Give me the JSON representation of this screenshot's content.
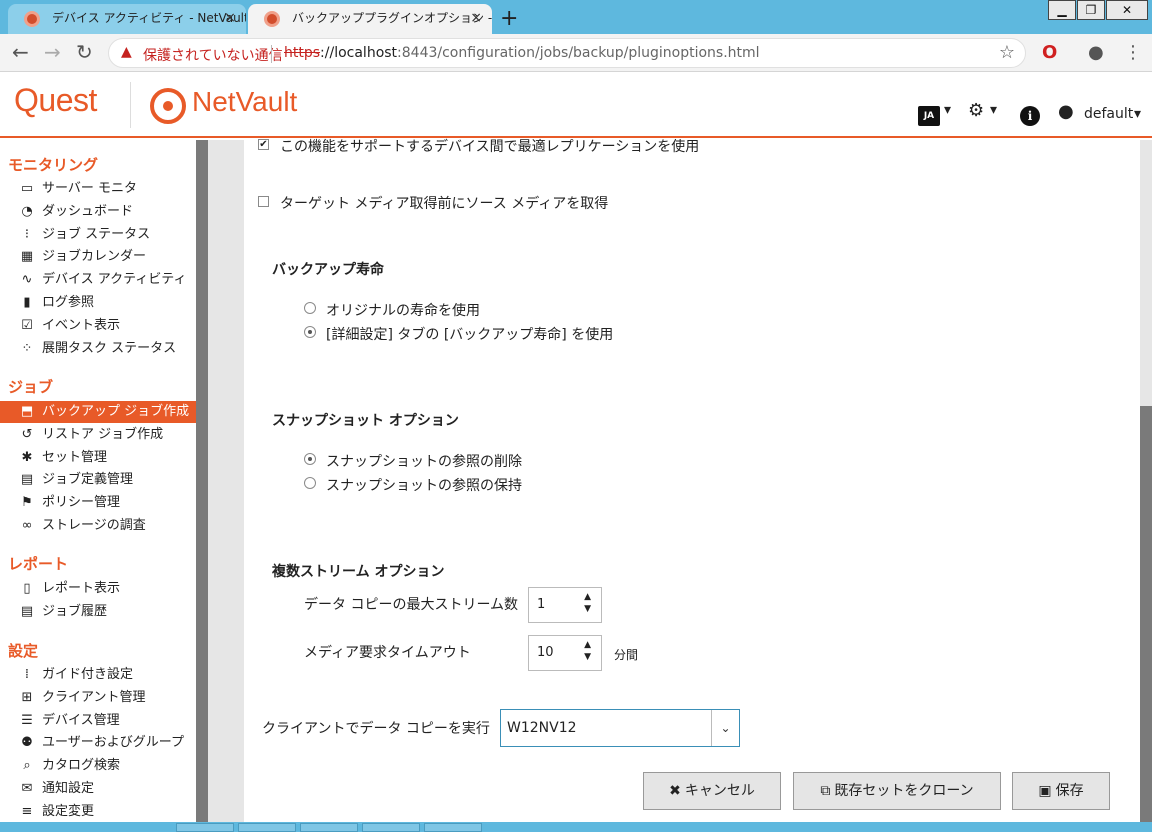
{
  "browser": {
    "tabs": [
      {
        "title": "デバイス アクティビティ - NetVault",
        "close": "×"
      },
      {
        "title": "バックアッププラグインオプション - Net",
        "close": "×"
      }
    ],
    "new_tab": "+",
    "window_controls": {
      "minimize": "▁",
      "maximize": "❐",
      "close": "✕"
    },
    "nav": {
      "back": "←",
      "forward": "→",
      "reload": "↻"
    },
    "security_text": "保護されていない通信",
    "url_scheme": "https",
    "url_host": "://localhost",
    "url_rest": ":8443/configuration/jobs/backup/pluginoptions.html"
  },
  "header": {
    "brand": "Quest",
    "product": "NetVault",
    "lang": "JA",
    "user": "default"
  },
  "sidebar": {
    "sections": [
      {
        "title": "モニタリング",
        "items": [
          {
            "icon": "monitor-icon",
            "glyph": "▭",
            "label": "サーバー モニタ"
          },
          {
            "icon": "dashboard-icon",
            "glyph": "◔",
            "label": "ダッシュボード"
          },
          {
            "icon": "traffic-light-icon",
            "glyph": "⁝",
            "label": "ジョブ ステータス"
          },
          {
            "icon": "calendar-icon",
            "glyph": "▦",
            "label": "ジョブカレンダー"
          },
          {
            "icon": "activity-icon",
            "glyph": "∿",
            "label": "デバイス アクティビティ"
          },
          {
            "icon": "log-icon",
            "glyph": "▮",
            "label": "ログ参照"
          },
          {
            "icon": "event-icon",
            "glyph": "☑",
            "label": "イベント表示"
          },
          {
            "icon": "spinner-icon",
            "glyph": "⁘",
            "label": "展開タスク ステータス"
          }
        ]
      },
      {
        "title": "ジョブ",
        "items": [
          {
            "icon": "backup-icon",
            "glyph": "⬒",
            "label": "バックアップ ジョブ作成",
            "active": true
          },
          {
            "icon": "restore-icon",
            "glyph": "↺",
            "label": "リストア ジョブ作成"
          },
          {
            "icon": "set-icon",
            "glyph": "✱",
            "label": "セット管理"
          },
          {
            "icon": "job-def-icon",
            "glyph": "▤",
            "label": "ジョブ定義管理"
          },
          {
            "icon": "policy-icon",
            "glyph": "⚑",
            "label": "ポリシー管理"
          },
          {
            "icon": "binoculars-icon",
            "glyph": "∞",
            "label": "ストレージの調査"
          }
        ]
      },
      {
        "title": "レポート",
        "items": [
          {
            "icon": "report-icon",
            "glyph": "▯",
            "label": "レポート表示"
          },
          {
            "icon": "history-icon",
            "glyph": "▤",
            "label": "ジョブ履歴"
          }
        ]
      },
      {
        "title": "設定",
        "items": [
          {
            "icon": "footsteps-icon",
            "glyph": "⁞",
            "label": "ガイド付き設定"
          },
          {
            "icon": "client-icon",
            "glyph": "⊞",
            "label": "クライアント管理"
          },
          {
            "icon": "device-icon",
            "glyph": "☰",
            "label": "デバイス管理"
          },
          {
            "icon": "users-icon",
            "glyph": "⚉",
            "label": "ユーザーおよびグループ"
          },
          {
            "icon": "catalog-search-icon",
            "glyph": "⌕",
            "label": "カタログ検索"
          },
          {
            "icon": "notify-icon",
            "glyph": "✉",
            "label": "通知設定"
          },
          {
            "icon": "settings-change-icon",
            "glyph": "≡",
            "label": "設定変更"
          }
        ]
      }
    ]
  },
  "main": {
    "opt_replication": {
      "checked": "✔",
      "label": "この機能をサポートするデバイス間で最適レプリケーションを使用"
    },
    "opt_source_media": {
      "checked": "",
      "label": "ターゲット メディア取得前にソース メディアを取得"
    },
    "lifetime": {
      "title": "バックアップ寿命",
      "options": [
        "オリジナルの寿命を使用",
        "[詳細設定] タブの [バックアップ寿命] を使用"
      ],
      "selected": 1
    },
    "snapshot": {
      "title": "スナップショット オプション",
      "options": [
        "スナップショットの参照の削除",
        "スナップショットの参照の保持"
      ],
      "selected": 0
    },
    "multistream": {
      "title": "複数ストリーム オプション",
      "max_streams_label": "データ コピーの最大ストリーム数",
      "max_streams_value": "1",
      "timeout_label": "メディア要求タイムアウト",
      "timeout_value": "10",
      "timeout_unit": "分間"
    },
    "client_copy": {
      "label": "クライアントでデータ コピーを実行",
      "value": "W12NV12"
    },
    "buttons": {
      "cancel": "キャンセル",
      "clone": "既存セットをクローン",
      "save": "保存"
    }
  }
}
